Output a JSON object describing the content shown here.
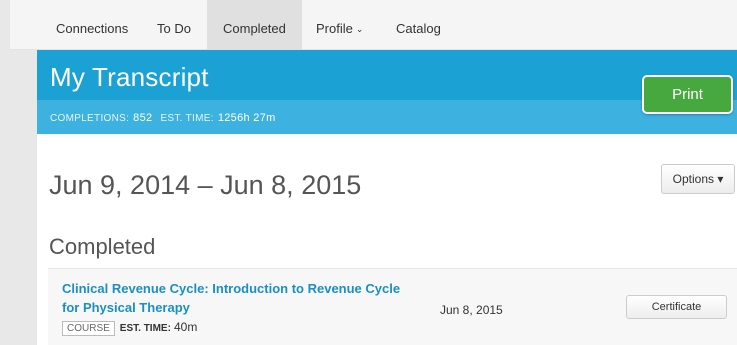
{
  "nav": {
    "items": [
      {
        "label": "Connections"
      },
      {
        "label": "To Do"
      },
      {
        "label": "Completed"
      },
      {
        "label": "Profile",
        "chevron": "⌄"
      },
      {
        "label": "Catalog"
      }
    ],
    "active": "Completed"
  },
  "header": {
    "title": "My Transcript",
    "completions_label": "COMPLETIONS:",
    "completions_value": "852",
    "est_time_label": "EST. TIME:",
    "est_time_value": "1256h 27m",
    "print_label": "Print"
  },
  "content": {
    "date_range": "Jun 9, 2014 – Jun 8, 2015",
    "options_label": "Options ▾",
    "section_title": "Completed",
    "rows": [
      {
        "title": "Clinical Revenue Cycle: Introduction to Revenue Cycle for Physical Therapy",
        "badge": "COURSE",
        "est_time_label": "EST. TIME:",
        "est_time_value": "40m",
        "date": "Jun 8, 2015",
        "action_label": "Certificate"
      }
    ]
  },
  "colors": {
    "header_blue": "#1ba1d4",
    "header_blue_light": "#3db1e0",
    "print_green": "#46a83e",
    "link_blue": "#1b8fc4"
  }
}
